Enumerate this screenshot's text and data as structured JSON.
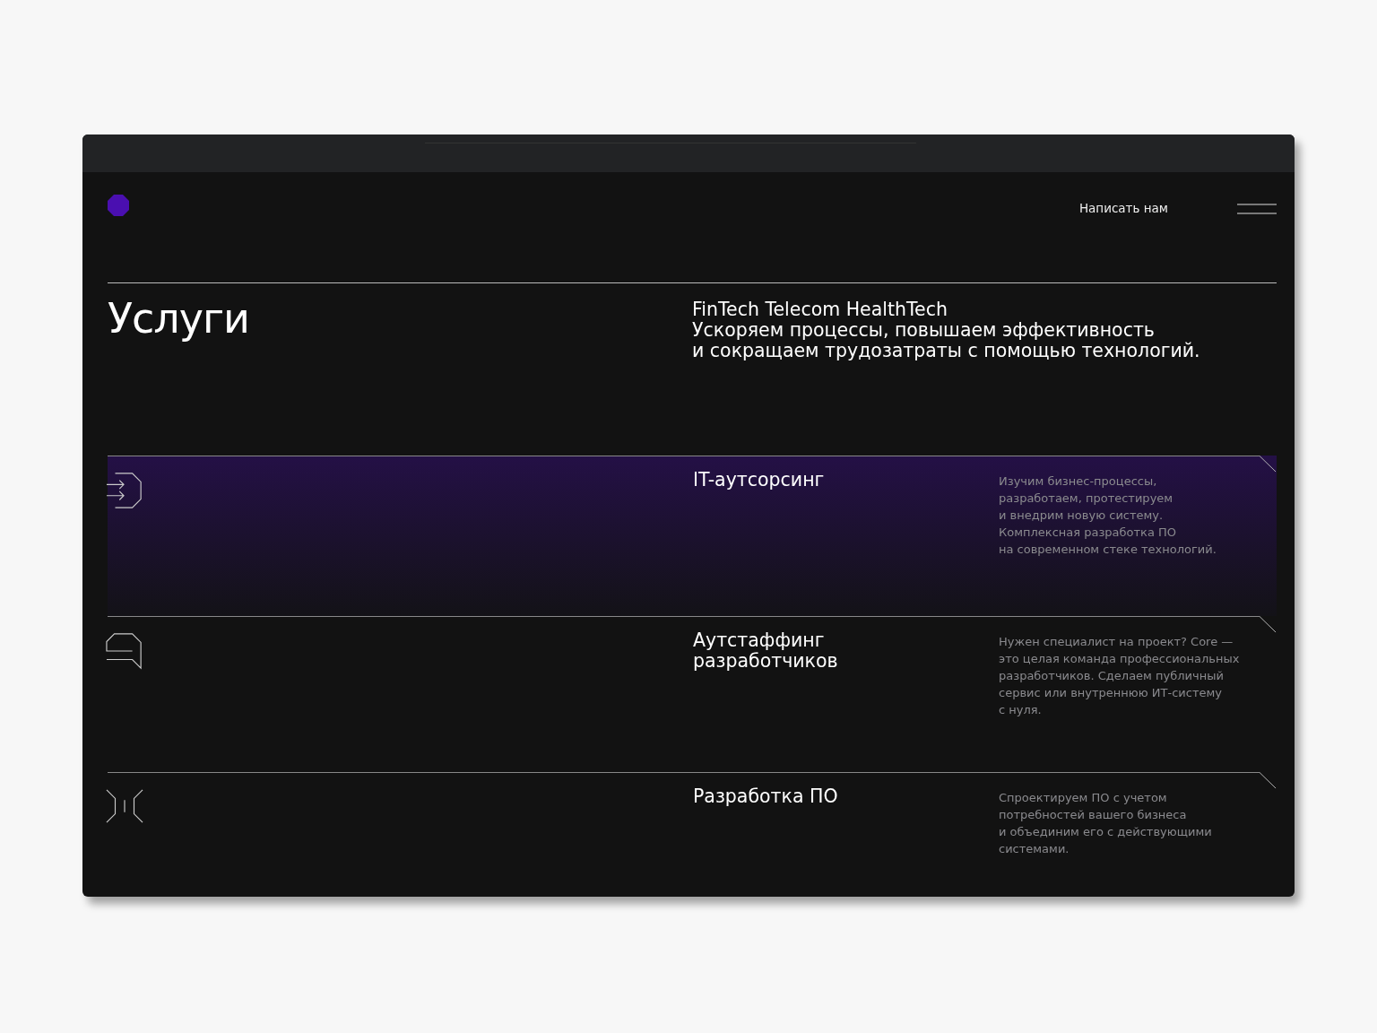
{
  "header": {
    "contact_link": "Написать нам"
  },
  "intro": {
    "title": "Услуги",
    "tags": "FinTech Telecom HealthTech",
    "subtitle": "Ускоряем процессы, повышаем эффективность\nи сокращаем трудозатраты с помощью технологий."
  },
  "services": [
    {
      "kind": "arrows",
      "selected": true,
      "title": "IT-аутсорсинг",
      "description": "Изучим бизнес-процессы,\nразработаем, протестируем\nи внедрим новую систему.\nКомплексная разработка ПО\nна современном стеке технологий."
    },
    {
      "kind": "chat",
      "selected": false,
      "title": "Аутстаффинг\nразработчиков",
      "description": "Нужен специалист на проект? Core —\nэто целая команда профессиональных\nразработчиков. Сделаем публичный\nсервис или внутреннюю ИТ-систему\nс нуля."
    },
    {
      "kind": "brackets",
      "selected": false,
      "title": "Разработка ПО",
      "description": "Спроектируем ПО с учетом\nпотребностей вашего бизнеса\nи объединим его с действующими\nсистемами."
    }
  ]
}
